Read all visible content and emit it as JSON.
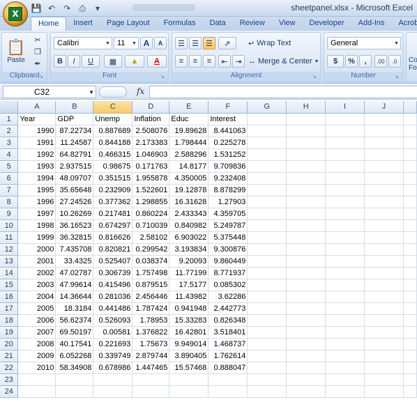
{
  "app": {
    "window_title": "sheetpanel.xlsx - Microsoft Excel",
    "office_logo_letter": "X"
  },
  "tabs": [
    "Home",
    "Insert",
    "Page Layout",
    "Formulas",
    "Data",
    "Review",
    "View",
    "Developer",
    "Add-Ins",
    "Acrob"
  ],
  "ribbon": {
    "clipboard": {
      "label": "Clipboard",
      "paste_label": "Paste"
    },
    "font": {
      "label": "Font",
      "font_name": "Calibri",
      "font_size": "11",
      "bold": "B",
      "italic": "I",
      "underline": "U",
      "grow": "A",
      "shrink": "A"
    },
    "alignment": {
      "label": "Alignment",
      "wrap_text": "Wrap Text",
      "merge_center": "Merge & Center"
    },
    "number": {
      "label": "Number",
      "format": "General",
      "currency": "$",
      "percent": "%",
      "comma": ",",
      "inc_decimal": ".00",
      "dec_decimal": ".0"
    },
    "styles_partial": "Co Fo"
  },
  "formula_bar": {
    "name_box": "C32",
    "fx": "fx",
    "formula": ""
  },
  "grid": {
    "columns": [
      "A",
      "B",
      "C",
      "D",
      "E",
      "F",
      "G",
      "H",
      "I",
      "J"
    ],
    "selected_column": "C",
    "rows": [
      [
        "Year",
        "GDP",
        "Unemp",
        "Inflation",
        "Educ",
        "Interest"
      ],
      [
        "1990",
        "87.22734",
        "0.887689",
        "2.508076",
        "19.89628",
        "8.441063"
      ],
      [
        "1991",
        "11.24587",
        "0.844188",
        "2.173383",
        "1.798444",
        "0.225278"
      ],
      [
        "1992",
        "64.82791",
        "0.466315",
        "1.046903",
        "2.588296",
        "1.531252"
      ],
      [
        "1993",
        "2.937515",
        "0.98675",
        "0.171763",
        "14.8177",
        "9.709836"
      ],
      [
        "1994",
        "48.09707",
        "0.351515",
        "1.955878",
        "4.350005",
        "9.232408"
      ],
      [
        "1995",
        "35.65648",
        "0.232909",
        "1.522601",
        "19.12878",
        "8.878299"
      ],
      [
        "1996",
        "27.24526",
        "0.377362",
        "1.298855",
        "16.31628",
        "1.27903"
      ],
      [
        "1997",
        "10.26269",
        "0.217481",
        "0.860224",
        "2.433343",
        "4.359705"
      ],
      [
        "1998",
        "36.16523",
        "0.674297",
        "0.710039",
        "0.840982",
        "5.249787"
      ],
      [
        "1999",
        "36.32815",
        "0.816626",
        "2.58102",
        "6.903022",
        "5.375448"
      ],
      [
        "2000",
        "7.435708",
        "0.820821",
        "0.299542",
        "3.193834",
        "9.300876"
      ],
      [
        "2001",
        "33.4325",
        "0.525407",
        "0.038374",
        "9.20093",
        "9.860449"
      ],
      [
        "2002",
        "47.02787",
        "0.306739",
        "1.757498",
        "11.77199",
        "8.771937"
      ],
      [
        "2003",
        "47.99614",
        "0.415496",
        "0.879515",
        "17.5177",
        "0.085302"
      ],
      [
        "2004",
        "14.36644",
        "0.281036",
        "2.456446",
        "11.43982",
        "3.62286"
      ],
      [
        "2005",
        "18.3184",
        "0.441486",
        "1.787424",
        "0.941948",
        "2.442773"
      ],
      [
        "2006",
        "56.62374",
        "0.526093",
        "1.78953",
        "15.33283",
        "0.826348"
      ],
      [
        "2007",
        "69.50197",
        "0.00581",
        "1.376822",
        "16.42801",
        "3.518401"
      ],
      [
        "2008",
        "40.17541",
        "0.221693",
        "1.75673",
        "9.949014",
        "1.468737"
      ],
      [
        "2009",
        "6.052268",
        "0.339749",
        "2.879744",
        "3.890405",
        "1.762614"
      ],
      [
        "2010",
        "58.34908",
        "0.678986",
        "1.447465",
        "15.57468",
        "0.888047"
      ],
      [],
      []
    ]
  }
}
